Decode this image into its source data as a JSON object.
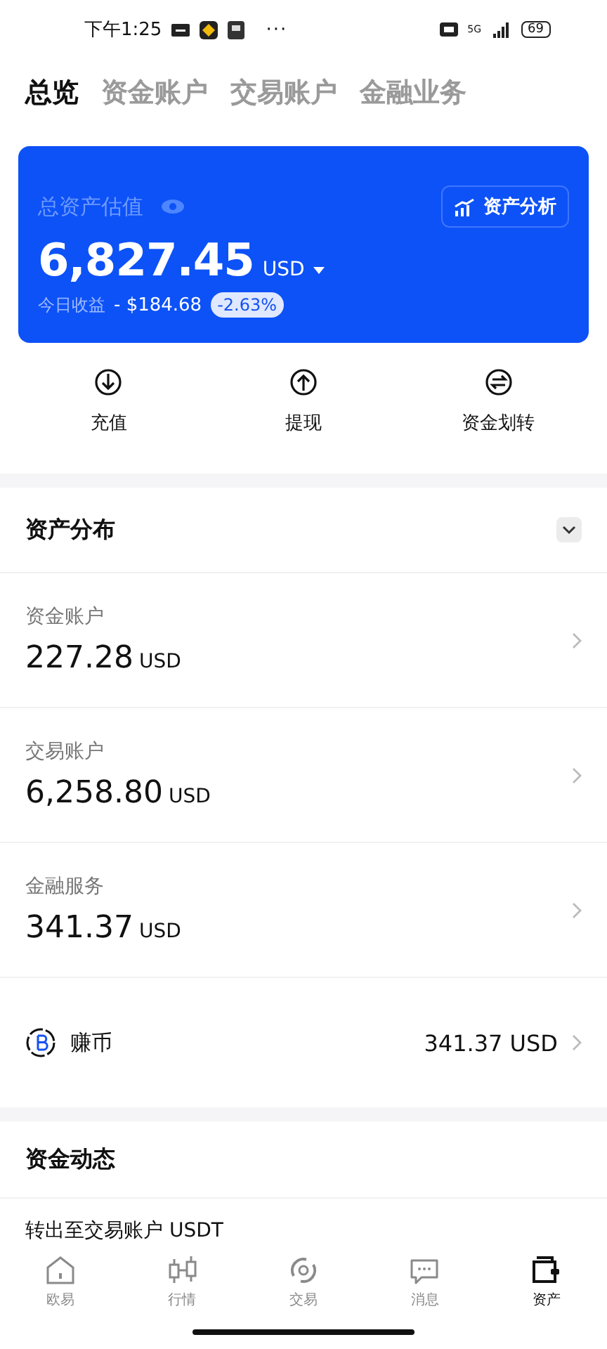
{
  "status_bar": {
    "time": "下午1:25",
    "more": "···",
    "network": "5G",
    "battery": "69"
  },
  "tabs": [
    {
      "label": "总览",
      "selected": true
    },
    {
      "label": "资金账户",
      "selected": false
    },
    {
      "label": "交易账户",
      "selected": false
    },
    {
      "label": "金融业务",
      "selected": false
    }
  ],
  "summary": {
    "title": "总资产估值",
    "analysis_button": "资产分析",
    "total": "6,827.45",
    "currency": "USD",
    "pnl_label": "今日收益",
    "pnl_value": "- $184.68",
    "pnl_percent": "-2.63%"
  },
  "actions": [
    {
      "label": "充值",
      "kind": "deposit"
    },
    {
      "label": "提现",
      "kind": "withdraw"
    },
    {
      "label": "资金划转",
      "kind": "transfer"
    }
  ],
  "distribution": {
    "title": "资产分布",
    "expanded": false,
    "accounts": [
      {
        "name": "资金账户",
        "value": "227.28",
        "currency": "USD"
      },
      {
        "name": "交易账户",
        "value": "6,258.80",
        "currency": "USD"
      },
      {
        "name": "金融服务",
        "value": "341.37",
        "currency": "USD"
      }
    ],
    "earn": {
      "name": "赚币",
      "value": "341.37 USD"
    }
  },
  "activity": {
    "title": "资金动态",
    "items": [
      "转出至交易账户 USDT"
    ]
  },
  "bottom_nav": [
    {
      "label": "欧易",
      "kind": "home",
      "selected": false
    },
    {
      "label": "行情",
      "kind": "market",
      "selected": false
    },
    {
      "label": "交易",
      "kind": "trade",
      "selected": false
    },
    {
      "label": "消息",
      "kind": "message",
      "selected": false
    },
    {
      "label": "资产",
      "kind": "wallet",
      "selected": true
    }
  ]
}
